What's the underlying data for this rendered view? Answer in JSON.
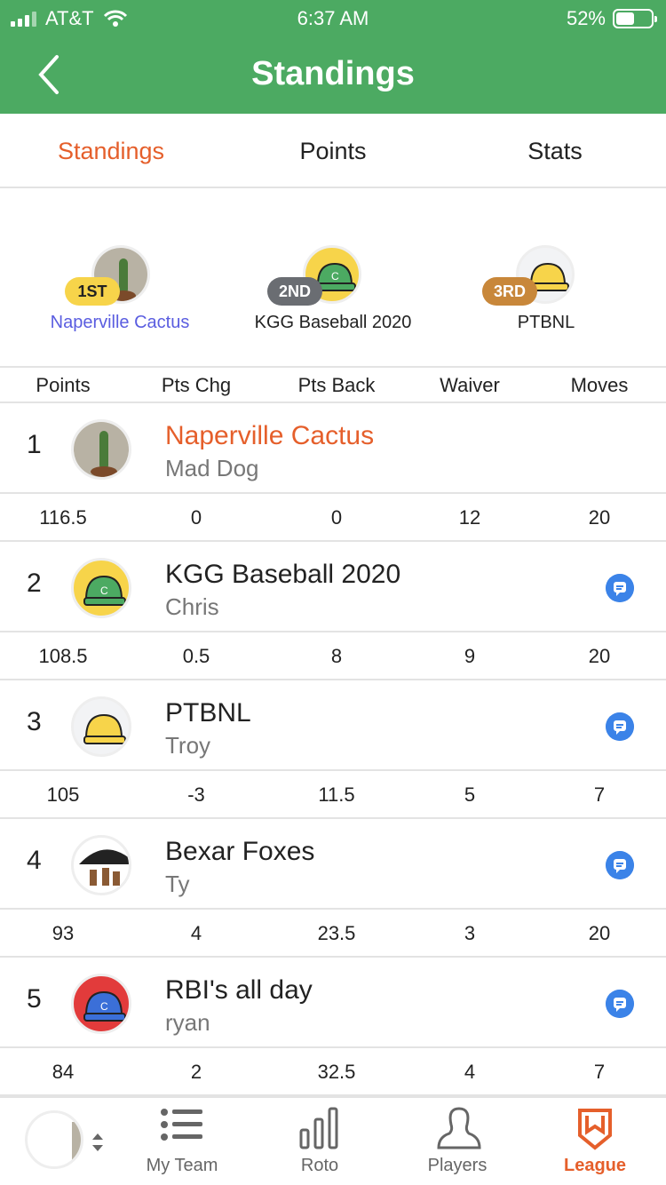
{
  "status": {
    "carrier": "AT&T",
    "time": "6:37 AM",
    "battery": "52%",
    "battery_level": 0.52
  },
  "header": {
    "title": "Standings"
  },
  "tabs": [
    {
      "label": "Standings",
      "active": true
    },
    {
      "label": "Points",
      "active": false
    },
    {
      "label": "Stats",
      "active": false
    }
  ],
  "podium": [
    {
      "badge": "1ST",
      "name": "Naperville Cactus"
    },
    {
      "badge": "2ND",
      "name": "KGG Baseball 2020"
    },
    {
      "badge": "3RD",
      "name": "PTBNL"
    }
  ],
  "columns": [
    "Points",
    "Pts Chg",
    "Pts Back",
    "Waiver",
    "Moves"
  ],
  "teams": [
    {
      "rank": "1",
      "name": "Naperville Cactus",
      "owner": "Mad Dog",
      "stats": [
        "116.5",
        "0",
        "0",
        "12",
        "20"
      ]
    },
    {
      "rank": "2",
      "name": "KGG Baseball 2020",
      "owner": "Chris",
      "stats": [
        "108.5",
        "0.5",
        "8",
        "9",
        "20"
      ]
    },
    {
      "rank": "3",
      "name": "PTBNL",
      "owner": "Troy",
      "stats": [
        "105",
        "-3",
        "11.5",
        "5",
        "7"
      ]
    },
    {
      "rank": "4",
      "name": "Bexar Foxes",
      "owner": "Ty",
      "stats": [
        "93",
        "4",
        "23.5",
        "3",
        "20"
      ]
    },
    {
      "rank": "5",
      "name": "RBI's all day",
      "owner": "ryan",
      "stats": [
        "84",
        "2",
        "32.5",
        "4",
        "7"
      ]
    }
  ],
  "nav": [
    {
      "label": "My Team",
      "icon": "list-icon"
    },
    {
      "label": "Roto",
      "icon": "bar-chart-icon"
    },
    {
      "label": "Players",
      "icon": "person-icon"
    },
    {
      "label": "League",
      "icon": "league-shield-icon"
    }
  ],
  "colors": {
    "header_green": "#4caa62",
    "accent_orange": "#e55f2b",
    "chat_blue": "#3b83e8",
    "podium_link": "#5a5de0"
  }
}
